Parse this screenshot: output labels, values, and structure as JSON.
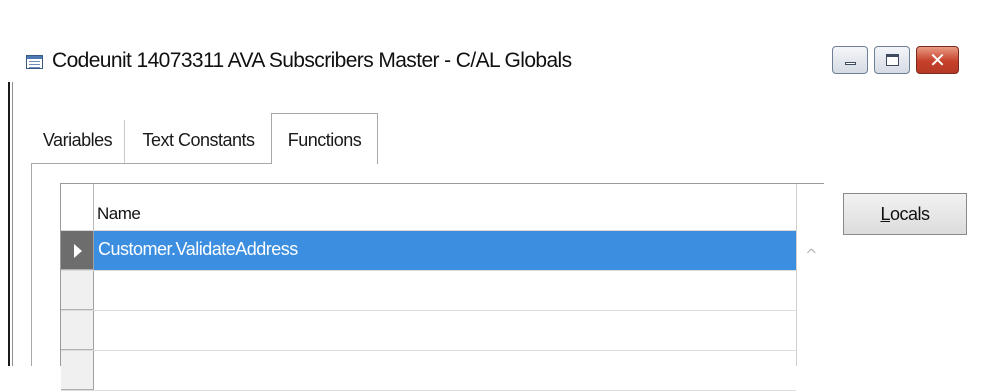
{
  "window": {
    "title": "Codeunit 14073311 AVA Subscribers Master - C/AL Globals",
    "controls": {
      "minimize": "minimize",
      "maximize": "maximize",
      "close": "✕"
    }
  },
  "tabs": [
    {
      "label": "Variables",
      "active": false
    },
    {
      "label": "Text Constants",
      "active": false
    },
    {
      "label": "Functions",
      "active": true
    }
  ],
  "grid": {
    "header": "Name",
    "rows": [
      {
        "name": "Customer.ValidateAddress",
        "selected": true
      },
      {
        "name": "",
        "selected": false
      },
      {
        "name": "",
        "selected": false
      },
      {
        "name": "",
        "selected": false
      }
    ]
  },
  "buttons": {
    "locals_first": "L",
    "locals_rest": "ocals"
  },
  "colors": {
    "selection": "#3b8ee0",
    "close_button": "#c6402a"
  }
}
